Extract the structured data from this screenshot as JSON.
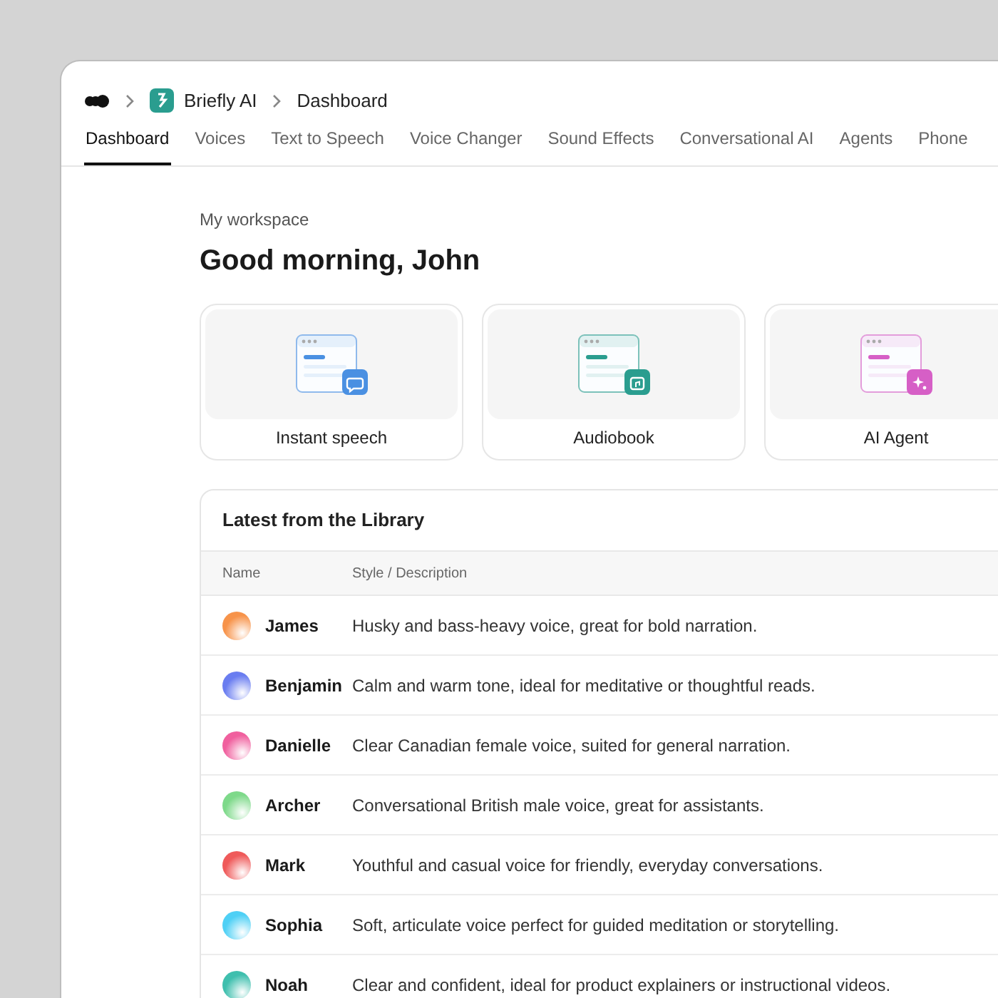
{
  "breadcrumb": {
    "workspace": "Briefly AI",
    "page": "Dashboard"
  },
  "tabs": [
    {
      "label": "Dashboard",
      "selected": true
    },
    {
      "label": "Voices",
      "selected": false
    },
    {
      "label": "Text to Speech",
      "selected": false
    },
    {
      "label": "Voice Changer",
      "selected": false
    },
    {
      "label": "Sound Effects",
      "selected": false
    },
    {
      "label": "Conversational AI",
      "selected": false
    },
    {
      "label": "Agents",
      "selected": false
    },
    {
      "label": "Phone",
      "selected": false
    }
  ],
  "eyebrow": "My workspace",
  "greeting": "Good morning, John",
  "cards": [
    {
      "label": "Instant speech",
      "kind": "chat",
      "color": "#4a90e2"
    },
    {
      "label": "Audiobook",
      "kind": "music",
      "color": "#2a9d8f"
    },
    {
      "label": "AI Agent",
      "kind": "sparkle",
      "color": "#d65fc6"
    }
  ],
  "library": {
    "title": "Latest from the Library",
    "columns": [
      "Name",
      "Style / Description"
    ],
    "rows": [
      {
        "name": "James",
        "description": "Husky and bass-heavy voice, great for bold narration.",
        "color": "#f7934a"
      },
      {
        "name": "Benjamin",
        "description": "Calm and warm tone, ideal for meditative or thoughtful reads.",
        "color": "#6a7df0"
      },
      {
        "name": "Danielle",
        "description": "Clear Canadian female voice, suited for general narration.",
        "color": "#f0609e"
      },
      {
        "name": "Archer",
        "description": "Conversational British male voice, great for assistants.",
        "color": "#7ed98a"
      },
      {
        "name": "Mark",
        "description": "Youthful and casual voice for friendly, everyday conversations.",
        "color": "#ef5a5a"
      },
      {
        "name": "Sophia",
        "description": "Soft, articulate voice perfect for guided meditation or storytelling.",
        "color": "#4fd0f5"
      },
      {
        "name": "Noah",
        "description": "Clear and confident, ideal for product explainers or instructional videos.",
        "color": "#3fbfae"
      }
    ]
  }
}
